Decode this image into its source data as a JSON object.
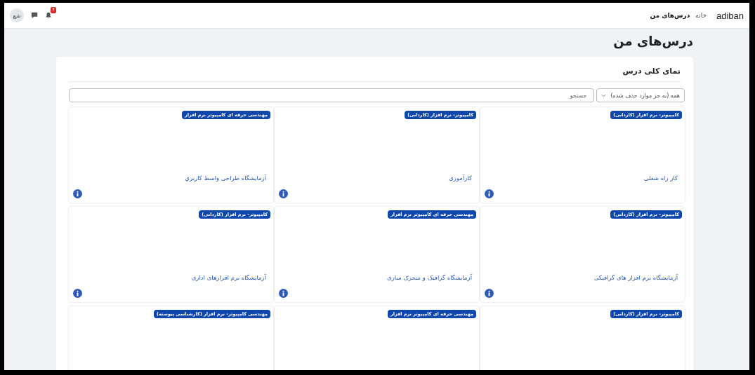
{
  "navbar": {
    "brand": "adiban",
    "links": [
      {
        "label": "خانه",
        "selected": false
      },
      {
        "label": "درس‌های من",
        "selected": true
      }
    ],
    "notification_count": "7",
    "avatar_initials": "شع"
  },
  "page_title": "درس‌های من",
  "course_overview": {
    "title": "نمای کلی درس",
    "filter": "همه (به جز موارد حذف شده)",
    "search": {
      "placeholder": "جستجو"
    },
    "courses": [
      {
        "category": "کامپیوتر- نرم افزار (کاردانی)",
        "name": "کار راه شغلی"
      },
      {
        "category": "کامپیوتر- نرم افزار (کاردانی)",
        "name": "کارآموزی"
      },
      {
        "category": "مهندسی حرفه ای کامپیوتر نرم افزار",
        "name": "آزمایشگاه طراحی واسط کاربري"
      },
      {
        "category": "کامپیوتر- نرم افزار (کاردانی)",
        "name": "آزمایشگاه نرم افزار های گرافیکی"
      },
      {
        "category": "مهندسی حرفه ای کامپیوتر نرم افزار",
        "name": "آزمایشگاه گرافیک و متحرک سازی"
      },
      {
        "category": "کامپیوتر- نرم افزار (کاردانی)",
        "name": "آزمایشگاه نرم افزارهای اداری"
      },
      {
        "category": "کامپیوتر- نرم افزار (کاردانی)"
      },
      {
        "category": "مهندسی حرفه ای کامپیوتر نرم افزار"
      },
      {
        "category": "مهندسی کامپیوتر- نرم افزار (کارشناسی پیوسته)"
      }
    ]
  }
}
